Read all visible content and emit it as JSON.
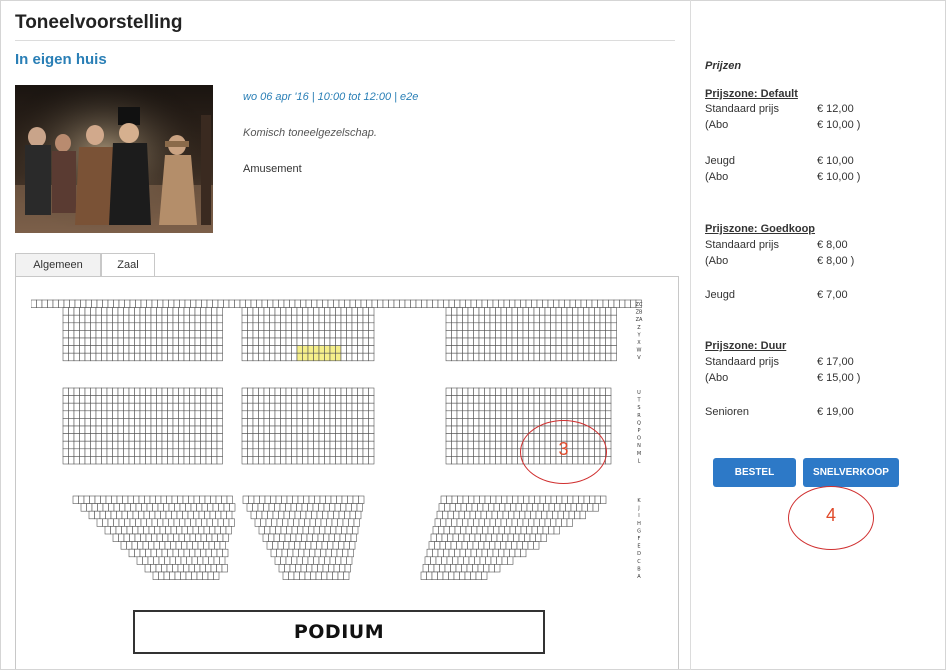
{
  "event": {
    "title": "Toneelvoorstelling",
    "subtitle": "In eigen huis",
    "date_line": "wo 06 apr '16 | 10:00 tot 12:00 | e2e",
    "description": "Komisch toneelgezelschap.",
    "category": "Amusement"
  },
  "tabs": [
    {
      "label": "Algemeen",
      "active": false
    },
    {
      "label": "Zaal",
      "active": true
    }
  ],
  "seatmap": {
    "stage_label": "PODIUM",
    "row_letters_upper": [
      "ZC",
      "ZB",
      "ZA",
      "Z",
      "Y",
      "X",
      "W",
      "V"
    ],
    "row_letters_middle": [
      "U",
      "T",
      "S",
      "R",
      "Q",
      "P",
      "O",
      "N",
      "M",
      "L"
    ],
    "row_letters_lower": [
      "K",
      "J",
      "I",
      "H",
      "G",
      "F",
      "E",
      "D",
      "C",
      "B",
      "A"
    ],
    "selected_color": "#f5ef8a"
  },
  "prices": {
    "heading": "Prijzen",
    "zones": [
      {
        "title": "Prijszone: Default",
        "rows": [
          {
            "label": "Standaard prijs",
            "value": "€ 12,00"
          },
          {
            "label": "(Abo",
            "value": "€ 10,00 )"
          },
          {
            "label": "Jeugd",
            "value": "€ 10,00"
          },
          {
            "label": "(Abo",
            "value": "€ 10,00 )"
          }
        ]
      },
      {
        "title": "Prijszone: Goedkoop",
        "rows": [
          {
            "label": "Standaard prijs",
            "value": "€ 8,00"
          },
          {
            "label": "(Abo",
            "value": "€ 8,00 )"
          },
          {
            "label": "Jeugd",
            "value": "€ 7,00"
          }
        ]
      },
      {
        "title": "Prijszone: Duur",
        "rows": [
          {
            "label": "Standaard prijs",
            "value": "€ 17,00"
          },
          {
            "label": "(Abo",
            "value": "€ 15,00 )"
          },
          {
            "label": "Senioren",
            "value": "€ 19,00"
          }
        ]
      }
    ]
  },
  "buttons": {
    "order": "BESTEL",
    "quick_sale": "SNELVERKOOP"
  },
  "annotations": {
    "callout_a": "3",
    "callout_b": "4",
    "color": "#d03030"
  },
  "colors": {
    "accent": "#2a7fb6",
    "button": "#2d79c7"
  }
}
